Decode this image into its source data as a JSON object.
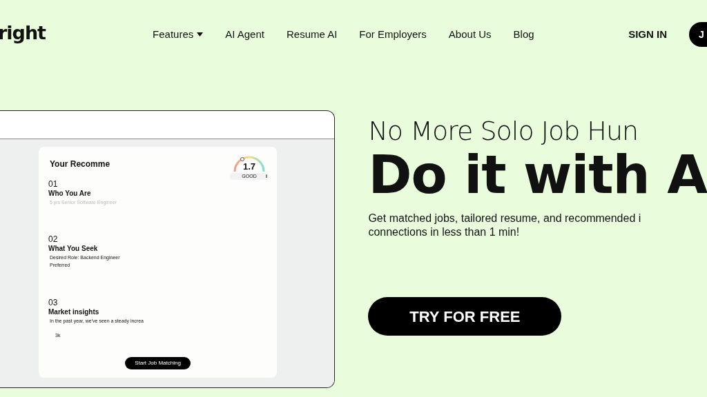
{
  "logo": "right",
  "nav": [
    {
      "label": "Features",
      "dropdown": true
    },
    {
      "label": "AI Agent",
      "dropdown": false
    },
    {
      "label": "Resume AI",
      "dropdown": false
    },
    {
      "label": "For Employers",
      "dropdown": false
    },
    {
      "label": "About Us",
      "dropdown": false
    },
    {
      "label": "Blog",
      "dropdown": false
    }
  ],
  "sign_in": "SIGN IN",
  "join_button": "J",
  "preview": {
    "title": "Your Recomme",
    "score": "1.7",
    "rating": "GOOD",
    "info": "i",
    "sections": [
      {
        "number": "01",
        "heading": "Who You Are",
        "lines": [
          "5 yrs Senior Software Engineer"
        ],
        "faded": true
      },
      {
        "number": "02",
        "heading": "What You Seek",
        "lines": [
          "Desired Role: Backend Engineer",
          "Preferred"
        ],
        "faded": false
      },
      {
        "number": "03",
        "heading": "Market insights",
        "lines": [
          "In the past year, we've seen a steady increa",
          "3k"
        ],
        "faded": false
      }
    ],
    "button": "Start Job Matching"
  },
  "hero": {
    "kicker": "No More Solo Job Hun",
    "headline": "Do it with A",
    "description": "Get matched jobs, tailored resume, and recommended i connections in less than 1 min!",
    "cta": "TRY FOR FREE"
  }
}
